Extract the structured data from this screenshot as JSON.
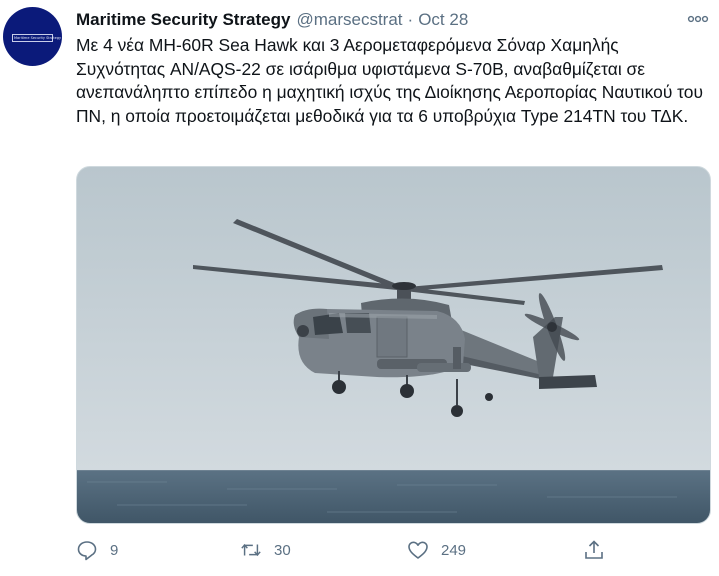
{
  "account": {
    "display_name": "Maritime Security Strategy",
    "handle": "@marsecstrat",
    "separator": "·",
    "date": "Oct 28",
    "avatar_logo_text": "Maritime Security Strategy"
  },
  "tweet": {
    "text": "Με 4 νέα MH-60R Sea Hawk και 3 Αερομεταφερόμενα Σόναρ Χαμηλής Συχνότητας AN/AQS-22 σε ισάριθμα υφιστάμενα S-70B, αναβαθμίζεται σε ανεπανάληπτο επίπεδο η μαχητική ισχύς της Διοίκησης Αεροπορίας Ναυτικού του ΠΝ, η οποία προετοιμάζεται μεθοδικά για τα 6 υποβρύχια Type 214TN του ΤΔΚ."
  },
  "media": {
    "subject": "helicopter-over-sea-photo"
  },
  "actions": {
    "reply": {
      "icon": "reply-icon",
      "count": "9"
    },
    "retweet": {
      "icon": "retweet-icon",
      "count": "30"
    },
    "like": {
      "icon": "like-icon",
      "count": "249"
    },
    "share": {
      "icon": "share-icon"
    }
  },
  "colors": {
    "text_primary": "#0f1419",
    "text_secondary": "#5b7083",
    "avatar_bg": "#0b1a7a",
    "sky": "#c9d3d8",
    "sea": "#4a6173"
  }
}
